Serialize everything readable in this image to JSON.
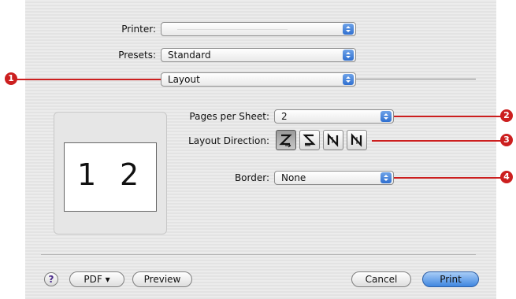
{
  "printer": {
    "label": "Printer:",
    "value": ""
  },
  "presets": {
    "label": "Presets:",
    "value": "Standard"
  },
  "panel": {
    "value": "Layout"
  },
  "pages_per_sheet": {
    "label": "Pages per Sheet:",
    "value": "2"
  },
  "layout_direction": {
    "label": "Layout Direction:",
    "selected_index": 0,
    "options": [
      "z-order",
      "reverse-z-order",
      "n-reverse",
      "n-order"
    ]
  },
  "border": {
    "label": "Border:",
    "value": "None"
  },
  "preview": {
    "page1": "1",
    "page2": "2"
  },
  "footer": {
    "help": "?",
    "pdf": "PDF ▾",
    "preview": "Preview",
    "cancel": "Cancel",
    "print": "Print"
  },
  "callouts": [
    "1",
    "2",
    "3",
    "4"
  ],
  "colors": {
    "callout": "#cc1f1f",
    "accent": "#3f86e0"
  }
}
